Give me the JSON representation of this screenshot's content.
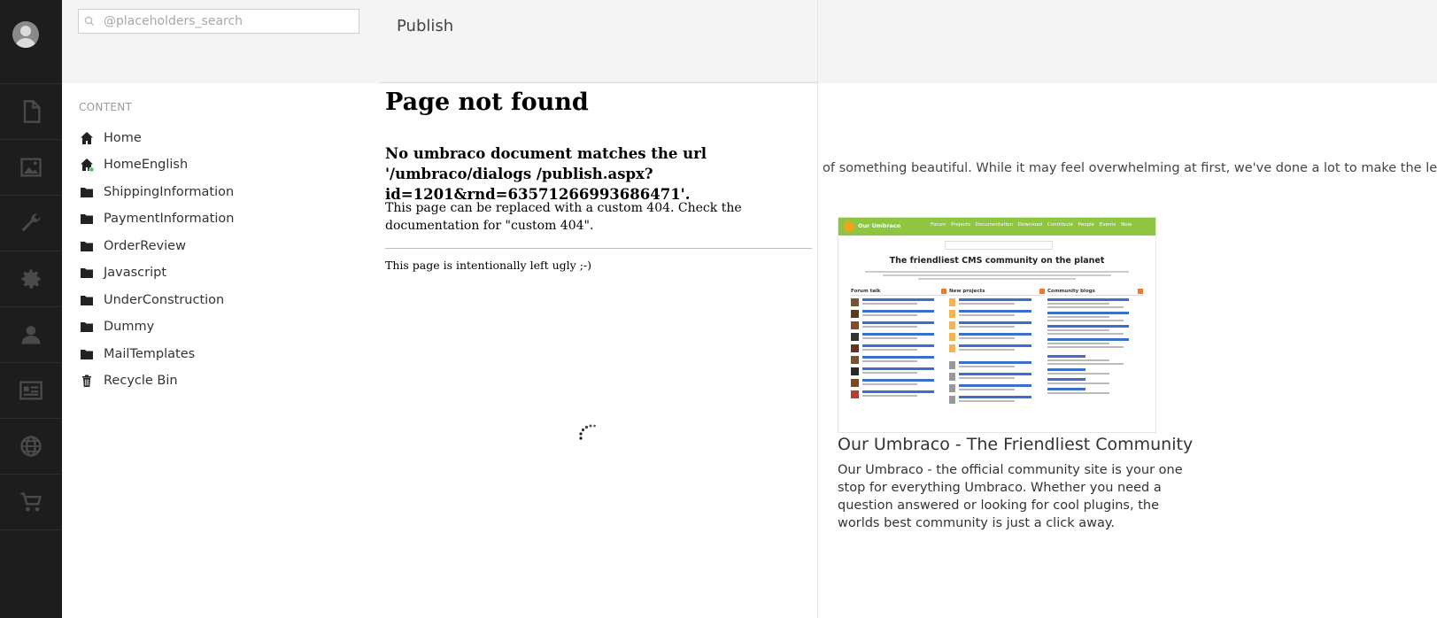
{
  "search": {
    "placeholder": "@placeholders_search"
  },
  "rail": {
    "sections": [
      "file-icon",
      "image-icon",
      "wrench-icon",
      "gear-icon",
      "user-icon",
      "id-card-icon",
      "globe-icon",
      "cart-icon"
    ]
  },
  "tree": {
    "section_title": "CONTENT",
    "items": [
      {
        "label": "Home",
        "icon": "home-icon"
      },
      {
        "label": "HomeEnglish",
        "icon": "home-icon"
      },
      {
        "label": "ShippingInformation",
        "icon": "folder-icon"
      },
      {
        "label": "PaymentInformation",
        "icon": "folder-icon"
      },
      {
        "label": "OrderReview",
        "icon": "folder-icon"
      },
      {
        "label": "Javascript",
        "icon": "folder-icon"
      },
      {
        "label": "UnderConstruction",
        "icon": "folder-icon"
      },
      {
        "label": "Dummy",
        "icon": "folder-icon"
      },
      {
        "label": "MailTemplates",
        "icon": "folder-icon"
      },
      {
        "label": "Recycle Bin",
        "icon": "trash-icon"
      }
    ]
  },
  "dialog": {
    "title": "Publish",
    "error_heading": "Page not found",
    "error_message": "No umbraco document matches the url '/umbraco/dialogs /publish.aspx?id=1201&rnd=63571266993686471'.",
    "custom_404_note": "This page can be replaced with a custom 404. Check the documentation for \"custom 404\".",
    "ugly_note": "This page is intentionally left ugly ;-)"
  },
  "dashboard": {
    "intro_text": "of something beautiful. While it may feel overwhelming at first, we've done a lot to make the learning",
    "thumbnail": {
      "brand": "Our Umbraco",
      "nav": "Forum Projects Documentation Download Contribute People Events Now",
      "headline": "The friendliest CMS community on the planet",
      "col1": "Forum talk",
      "col2": "New projects",
      "col3": "Community blogs"
    },
    "card_title": "Our Umbraco - The Friendliest Community",
    "card_description": "Our Umbraco - the official community site is your one stop for everything Umbraco. Whether you need a question answered or looking for cool plugins, the worlds best community is just a click away."
  }
}
